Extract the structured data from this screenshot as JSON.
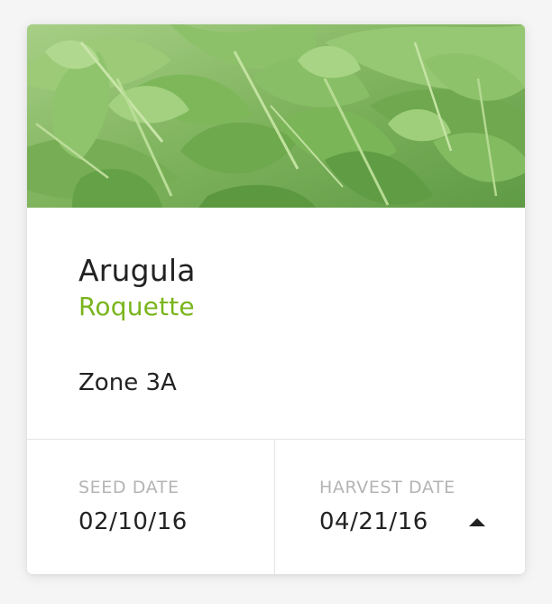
{
  "card": {
    "image_alt": "Arugula leaves",
    "title": "Arugula",
    "subtitle": "Roquette",
    "zone": "Zone 3A",
    "accent_color": "#7ab51d",
    "seed": {
      "label": "SEED DATE",
      "value": "02/10/16"
    },
    "harvest": {
      "label": "HARVEST DATE",
      "value": "04/21/16",
      "toggle_icon": "caret-up-icon"
    }
  }
}
